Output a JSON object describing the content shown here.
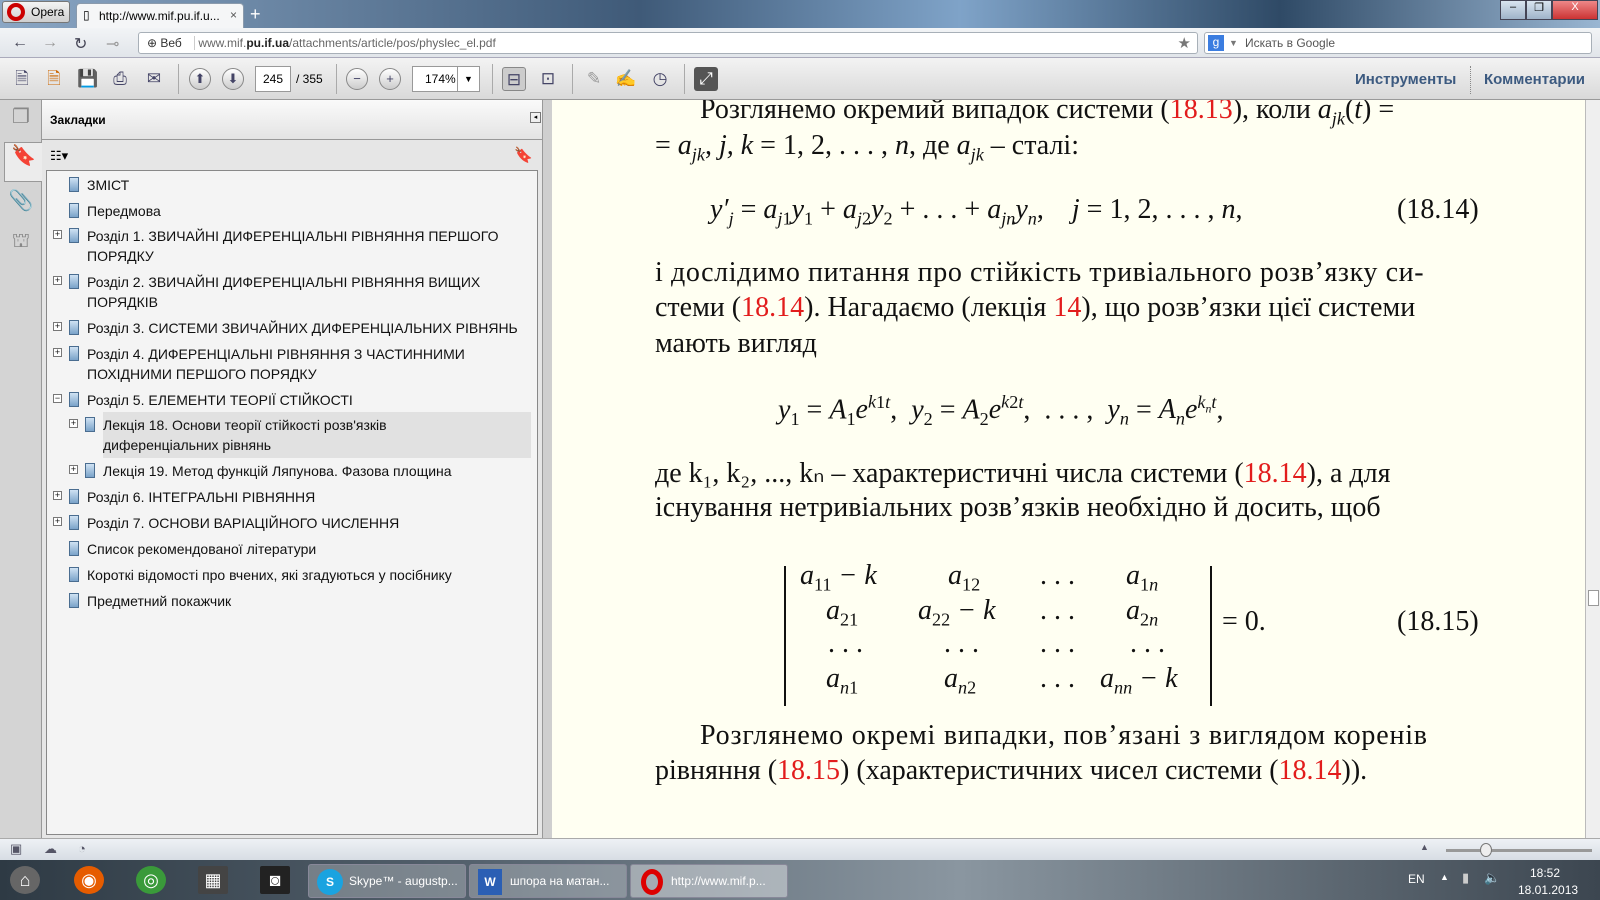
{
  "browser": {
    "opera_label": "Opera",
    "tab_title": "http://www.mif.pu.if.u...",
    "url_prefix": "Веб",
    "url_host_pre": "www.mif.",
    "url_host_bold": "pu.if.ua",
    "url_path": "/attachments/article/pos/physlec_el.pdf",
    "search_placeholder": "Искать в Google",
    "search_engine": "g"
  },
  "pdf_toolbar": {
    "page_current": "245",
    "page_total": "/ 355",
    "zoom": "174%",
    "tools_label": "Инструменты",
    "comments_label": "Комментарии"
  },
  "bookmarks": {
    "title": "Закладки",
    "items": [
      {
        "label": "ЗМІСТ",
        "expander": ""
      },
      {
        "label": "Передмова",
        "expander": ""
      },
      {
        "label": "Розділ 1. ЗВИЧАЙНІ ДИФЕРЕНЦІАЛЬНІ РІВНЯННЯ ПЕРШОГО",
        "label2": "ПОРЯДКУ",
        "expander": "+"
      },
      {
        "label": "Розділ 2. ЗВИЧАЙНІ ДИФЕРЕНЦІАЛЬНІ РІВНЯННЯ ВИЩИХ",
        "label2": "ПОРЯДКІВ",
        "expander": "+"
      },
      {
        "label": "Розділ 3. СИСТЕМИ ЗВИЧАЙНИХ ДИФЕРЕНЦІАЛЬНИХ РІВНЯНЬ",
        "expander": "+"
      },
      {
        "label": "Розділ 4. ДИФЕРЕНЦІАЛЬНІ РІВНЯННЯ З ЧАСТИННИМИ",
        "label2": "ПОХІДНИМИ ПЕРШОГО ПОРЯДКУ",
        "expander": "+"
      },
      {
        "label": "Розділ 5. ЕЛЕМЕНТИ ТЕОРІЇ СТІЙКОСТІ",
        "expander": "−"
      },
      {
        "label": "Лекція 18. Основи теорії стійкості розв'язків",
        "label2": "диференціальних рівнянь",
        "expander": "+"
      },
      {
        "label": "Лекція 19. Метод функцій Ляпунова. Фазова площина",
        "expander": "+"
      },
      {
        "label": "Розділ 6. ІНТЕГРАЛЬНІ РІВНЯННЯ",
        "expander": "+"
      },
      {
        "label": "Розділ 7. ОСНОВИ ВАРІАЦІЙНОГО ЧИСЛЕННЯ",
        "expander": "+"
      },
      {
        "label": "Список рекомендованої літератури",
        "expander": ""
      },
      {
        "label": "Короткі відомості про вчених, які згадуються у посібнику",
        "expander": ""
      },
      {
        "label": "Предметний покажчик",
        "expander": ""
      }
    ]
  },
  "document": {
    "p1a": "Розглянемо окремий випадок системи (",
    "ref1813": "18.13",
    "p1b": "), коли ",
    "p2": "= a_jk, j,k = 1,2,...,n, де a_jk – сталі:",
    "eq1814": "(18.14)",
    "p3": "і дослідимо питання про стійкість тривіального розв’язку си-",
    "p4a": "стеми (",
    "ref1814": "18.14",
    "p4b": "). Нагадаємо (лекція ",
    "ref14": "14",
    "p4c": "), що розв’язки цієї системи",
    "p5": "мають вигляд",
    "p6a": "де k₁, k₂, ..., kₙ – характеристичні числа системи (",
    "p6b": "), а для",
    "p7": "існування нетривіальних розв’язків необхідно й досить, щоб",
    "eq1815": "(18.15)",
    "p8": "Розглянемо окремі випадки, пов’язані з виглядом коренів",
    "p9a": "рівняння (",
    "ref1815": "18.15",
    "p9b": ") (характеристичних чисел системи (",
    "p9c": "))."
  },
  "taskbar": {
    "tasks": [
      "Skype™ - augustp...",
      "шпора на матан...",
      "http://www.mif.p..."
    ],
    "lang": "EN",
    "time": "18:52",
    "date": "18.01.2013"
  },
  "colors": {
    "ref_red": "#e21c1c",
    "doc_bg": "#fffff2"
  }
}
